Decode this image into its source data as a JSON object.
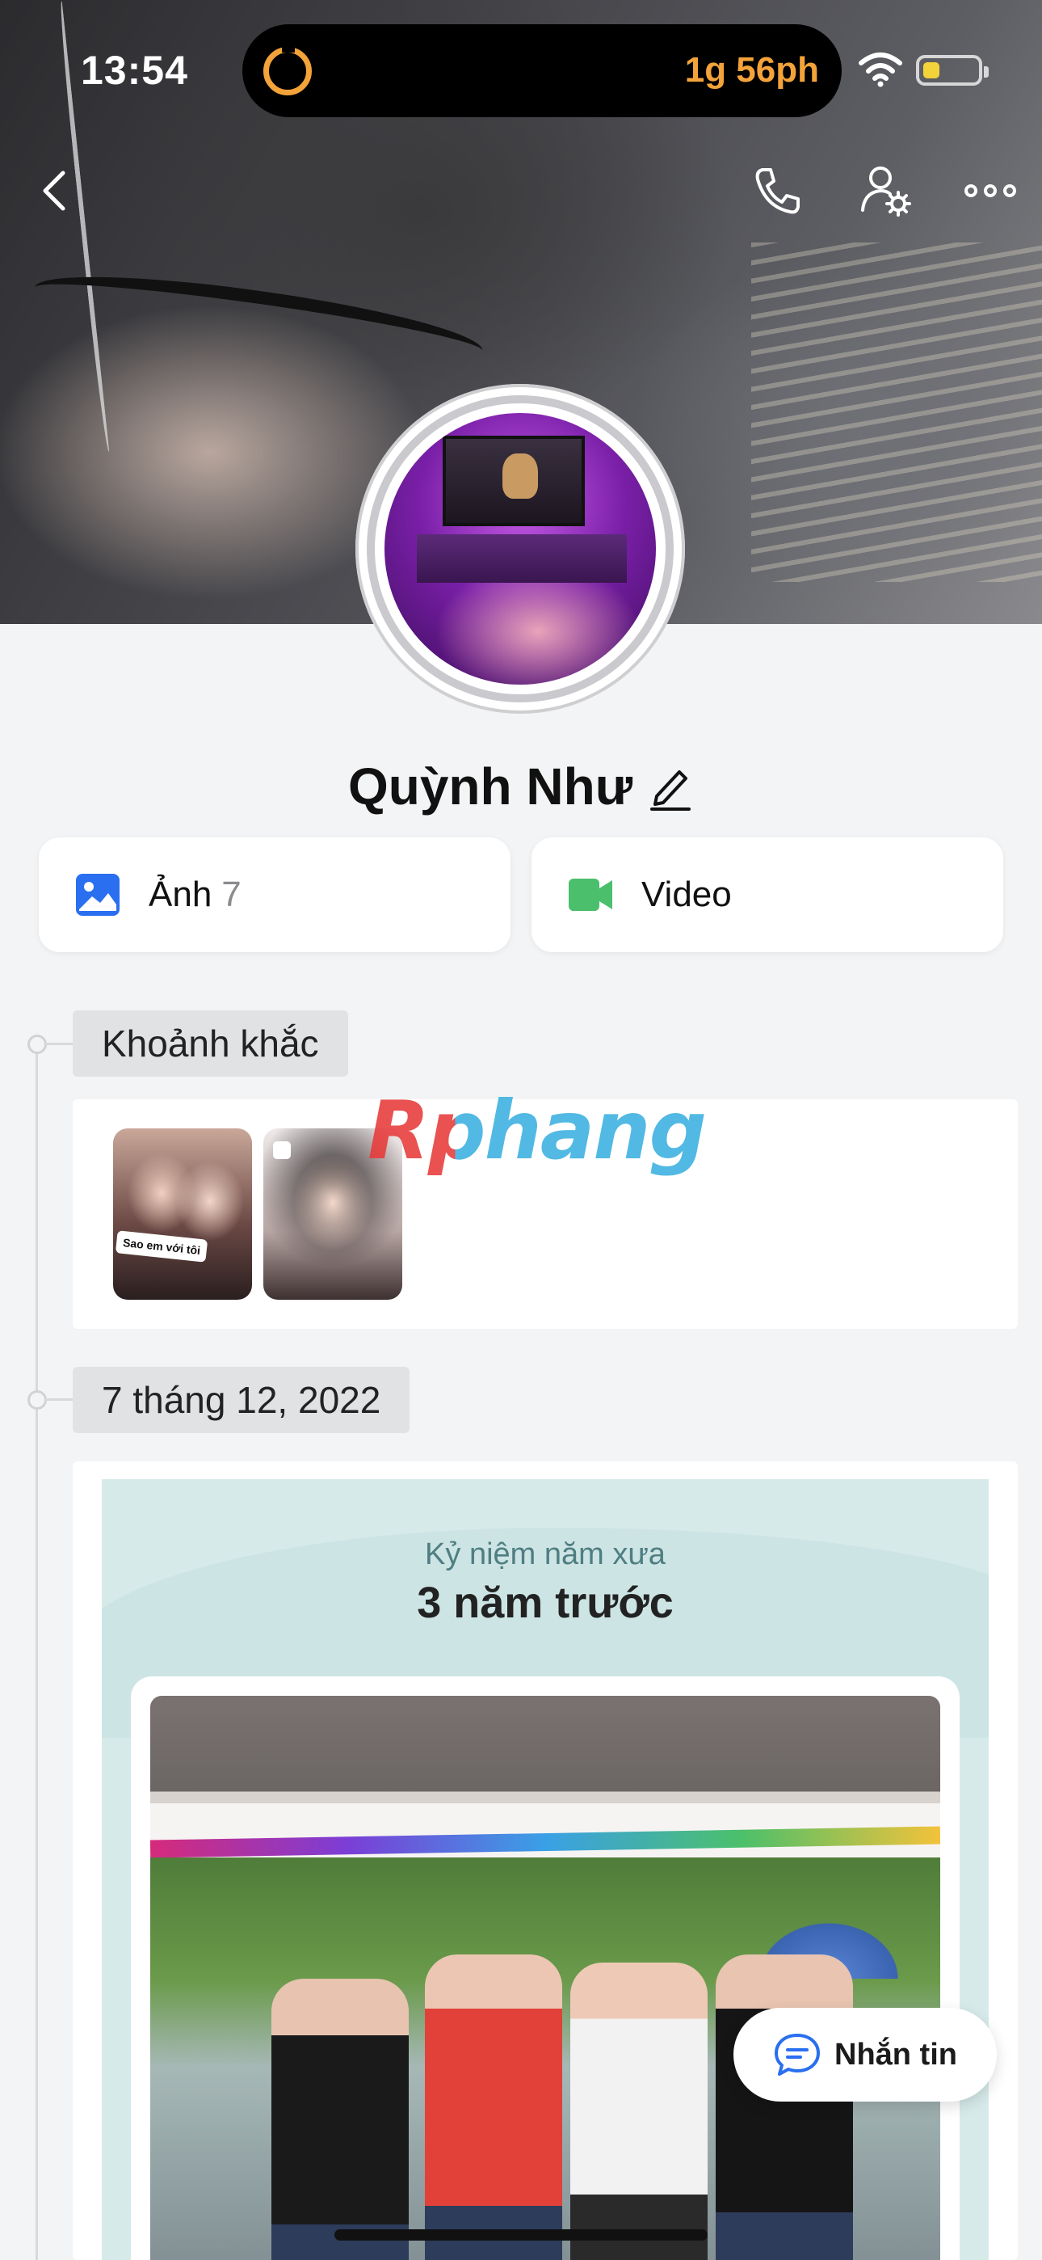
{
  "status_bar": {
    "time": "13:54",
    "activity_text": "1g 56ph",
    "activity_icon": "timer-icon",
    "wifi_icon": "wifi-icon",
    "battery_icon": "battery-low-icon",
    "battery_level": 0.3
  },
  "header": {
    "back_icon": "chevron-left-icon",
    "call_icon": "phone-icon",
    "settings_icon": "user-settings-icon",
    "more_icon": "more-horizontal-icon"
  },
  "profile": {
    "name": "Quỳnh Như",
    "edit_icon": "pencil-icon"
  },
  "media": {
    "photos_label": "Ảnh",
    "photos_count": "7",
    "video_label": "Video",
    "photos_color": "#2a6ff0",
    "video_color": "#4bbf6b"
  },
  "timeline": {
    "moments_title": "Khoảnh khắc",
    "moment_caption": "Sao em với tôi",
    "date_label": "7 tháng 12, 2022",
    "memory_kicker": "Kỷ niệm năm xưa",
    "memory_heading": "3 năm trước"
  },
  "actions": {
    "message_label": "Nhắn tin",
    "message_icon": "chat-bubble-icon"
  },
  "watermark": {
    "text": "Rphang"
  },
  "colors": {
    "accent": "#2a6ff0",
    "activity": "#f3a33a",
    "video": "#4bbf6b",
    "memory_bg": "#d7eaea"
  }
}
